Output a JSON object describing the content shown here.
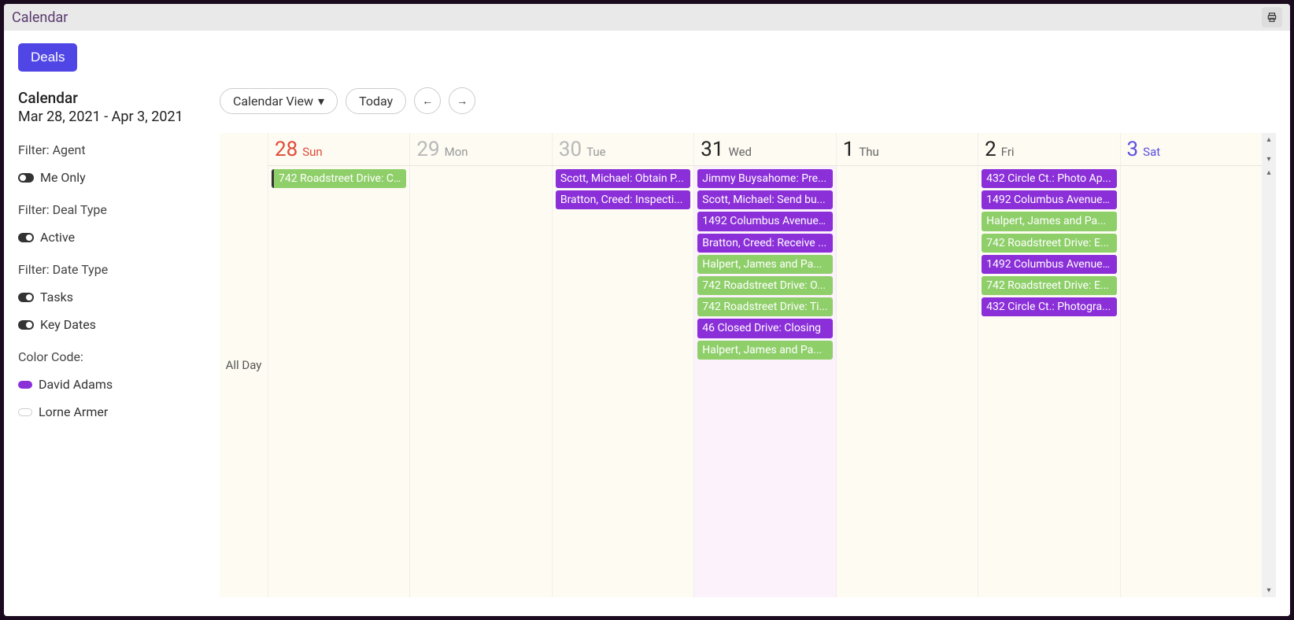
{
  "window": {
    "title": "Calendar"
  },
  "sidebar": {
    "deals_label": "Deals",
    "heading": "Calendar",
    "daterange": "Mar 28, 2021 - Apr 3, 2021",
    "filter_agent_label": "Filter: Agent",
    "me_only_label": "Me Only",
    "filter_dealtype_label": "Filter: Deal Type",
    "active_label": "Active",
    "filter_datetype_label": "Filter: Date Type",
    "tasks_label": "Tasks",
    "keydates_label": "Key Dates",
    "colorcode_label": "Color Code:",
    "legend": [
      {
        "name": "David Adams",
        "color": "#8b2fd9"
      },
      {
        "name": "Lorne Armer",
        "color": "#ffffff"
      }
    ]
  },
  "controls": {
    "view_label": "Calendar View",
    "today_label": "Today"
  },
  "timecol_label": "All Day",
  "days": [
    {
      "num": "28",
      "name": "Sun",
      "numColor": "#e04a3a",
      "nameColor": "#e04a3a",
      "isToday": false,
      "events": [
        {
          "text": "742 Roadstreet Drive: C...",
          "color": "green",
          "bar": true
        }
      ]
    },
    {
      "num": "29",
      "name": "Mon",
      "numColor": "#b8b8b8",
      "nameColor": "#999",
      "isToday": false,
      "events": []
    },
    {
      "num": "30",
      "name": "Tue",
      "numColor": "#b8b8b8",
      "nameColor": "#999",
      "isToday": false,
      "events": [
        {
          "text": "Scott, Michael: Obtain P...",
          "color": "purple"
        },
        {
          "text": "Bratton, Creed: Inspecti...",
          "color": "purple"
        }
      ]
    },
    {
      "num": "31",
      "name": "Wed",
      "numColor": "#222",
      "nameColor": "#666",
      "isToday": true,
      "events": [
        {
          "text": "Jimmy Buysahome: Pre...",
          "color": "purple"
        },
        {
          "text": "Scott, Michael: Send bu...",
          "color": "purple"
        },
        {
          "text": "1492 Columbus Avenue:...",
          "color": "purple"
        },
        {
          "text": "Bratton, Creed: Receive ...",
          "color": "purple"
        },
        {
          "text": "Halpert, James and Pa...",
          "color": "green"
        },
        {
          "text": "742 Roadstreet Drive: O...",
          "color": "green"
        },
        {
          "text": "742 Roadstreet Drive: Ti...",
          "color": "green"
        },
        {
          "text": "46 Closed Drive: Closing",
          "color": "purple"
        },
        {
          "text": "Halpert, James and Pa...",
          "color": "green"
        }
      ]
    },
    {
      "num": "1",
      "name": "Thu",
      "numColor": "#222",
      "nameColor": "#666",
      "isToday": false,
      "events": []
    },
    {
      "num": "2",
      "name": "Fri",
      "numColor": "#222",
      "nameColor": "#666",
      "isToday": false,
      "events": [
        {
          "text": "432 Circle Ct.: Photo Ap...",
          "color": "purple"
        },
        {
          "text": "1492 Columbus Avenue:...",
          "color": "purple"
        },
        {
          "text": "Halpert, James and Pa...",
          "color": "green"
        },
        {
          "text": "742 Roadstreet Drive: E...",
          "color": "green"
        },
        {
          "text": "1492 Columbus Avenue:...",
          "color": "purple"
        },
        {
          "text": "742 Roadstreet Drive: E...",
          "color": "green"
        },
        {
          "text": "432 Circle Ct.: Photogra...",
          "color": "purple"
        }
      ]
    },
    {
      "num": "3",
      "name": "Sat",
      "numColor": "#5a4ee0",
      "nameColor": "#5a4ee0",
      "isToday": false,
      "events": []
    }
  ]
}
